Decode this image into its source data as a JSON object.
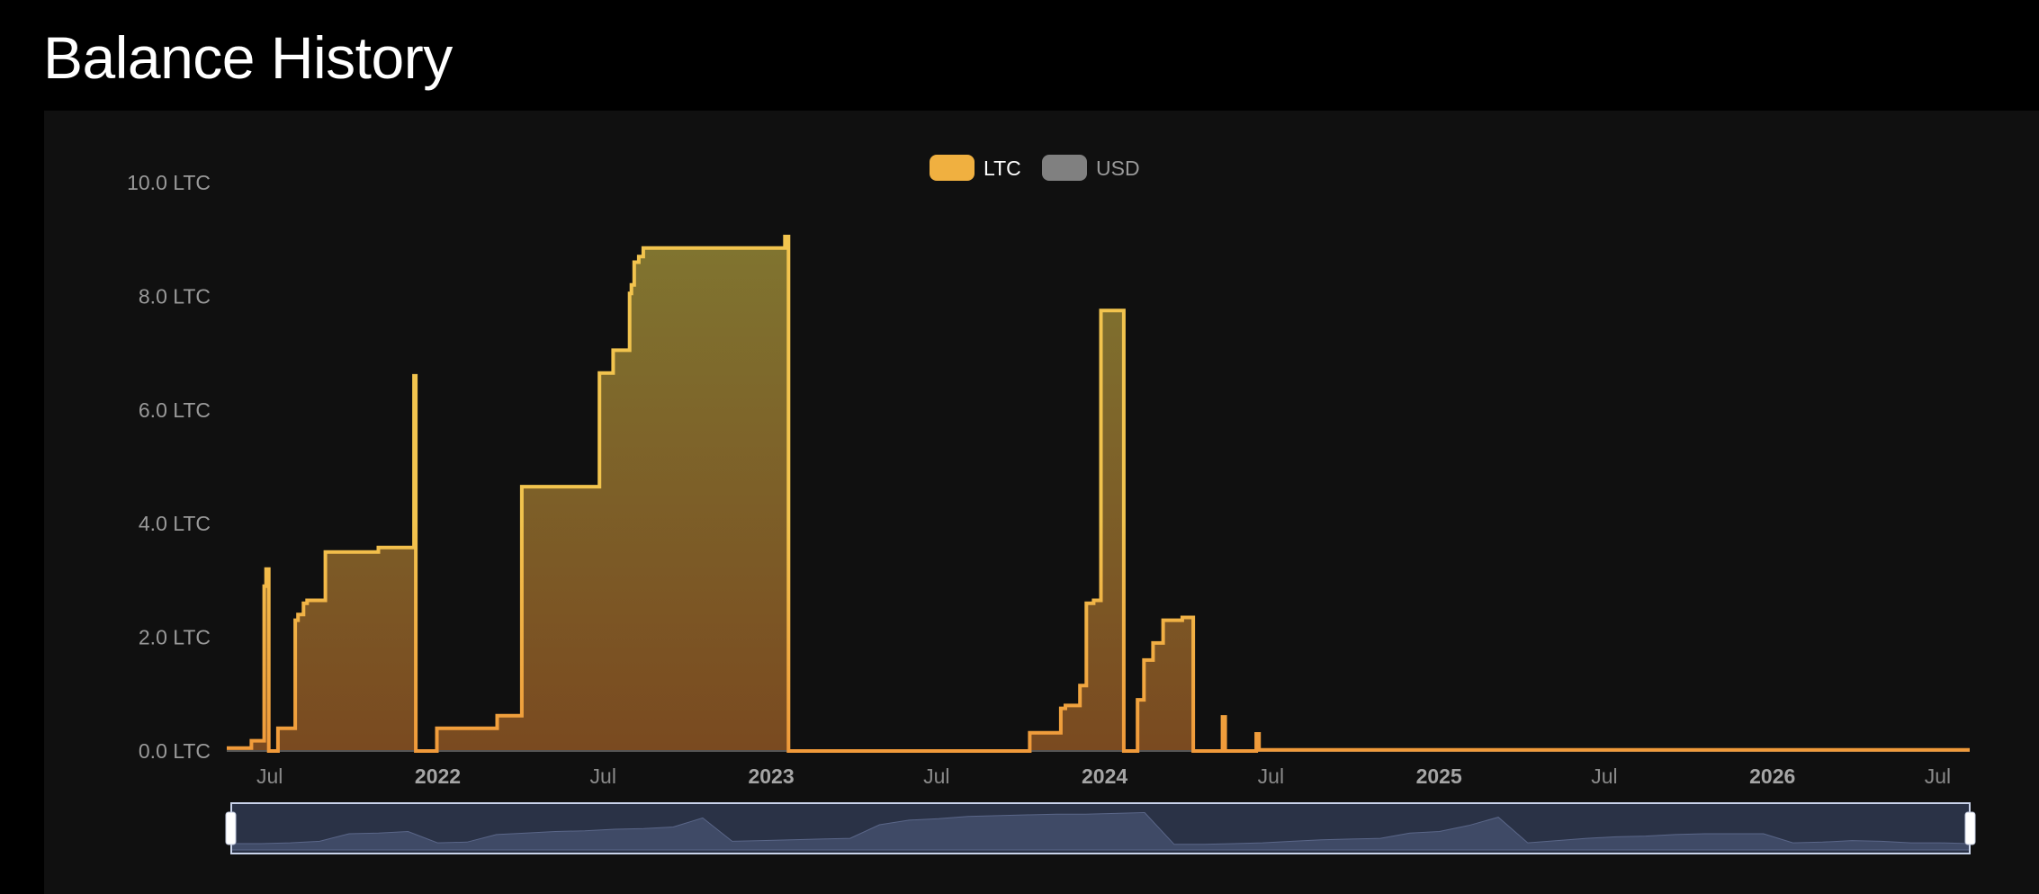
{
  "page": {
    "title": "Balance History"
  },
  "legend": [
    {
      "label": "LTC",
      "color": "#f0b040",
      "text_color": "#ffffff",
      "active": true
    },
    {
      "label": "USD",
      "color": "#808080",
      "text_color": "#9a9a9a",
      "active": false
    }
  ],
  "colors": {
    "line_ltc": "#f2c44e",
    "line_ltc_low": "#f09a3a",
    "fill_top": "#807530",
    "fill_bottom": "#7a4a20",
    "axis": "#555555",
    "navigator_fill": "#2a3246",
    "navigator_series": "#3f4a66",
    "navigator_border": "#c9d3ea",
    "background": "#101010"
  },
  "chart_data": {
    "type": "area",
    "step": true,
    "x_axis": {
      "type": "date",
      "min": "2021-05-15",
      "max": "2026-08-05",
      "ticks": [
        {
          "date": "2021-07-01",
          "label": "Jul",
          "year": false
        },
        {
          "date": "2022-01-01",
          "label": "2022",
          "year": true
        },
        {
          "date": "2022-07-01",
          "label": "Jul",
          "year": false
        },
        {
          "date": "2023-01-01",
          "label": "2023",
          "year": true
        },
        {
          "date": "2023-07-01",
          "label": "Jul",
          "year": false
        },
        {
          "date": "2024-01-01",
          "label": "2024",
          "year": true
        },
        {
          "date": "2024-07-01",
          "label": "Jul",
          "year": false
        },
        {
          "date": "2025-01-01",
          "label": "2025",
          "year": true
        },
        {
          "date": "2025-07-01",
          "label": "Jul",
          "year": false
        },
        {
          "date": "2026-01-01",
          "label": "2026",
          "year": true
        },
        {
          "date": "2026-07-01",
          "label": "Jul",
          "year": false
        }
      ]
    },
    "y_axis": {
      "min": 0,
      "max": 10,
      "ticks": [
        {
          "value": 0,
          "label": "0.0 LTC"
        },
        {
          "value": 2,
          "label": "2.0 LTC"
        },
        {
          "value": 4,
          "label": "4.0 LTC"
        },
        {
          "value": 6,
          "label": "6.0 LTC"
        },
        {
          "value": 8,
          "label": "8.0 LTC"
        },
        {
          "value": 10,
          "label": "10.0 LTC"
        }
      ]
    },
    "series": [
      {
        "name": "LTC",
        "points": [
          [
            "2021-05-15",
            0.05
          ],
          [
            "2021-06-11",
            0.18
          ],
          [
            "2021-06-25",
            2.9
          ],
          [
            "2021-06-27",
            3.2
          ],
          [
            "2021-06-30",
            0.0
          ],
          [
            "2021-07-10",
            0.4
          ],
          [
            "2021-07-29",
            2.3
          ],
          [
            "2021-08-01",
            2.4
          ],
          [
            "2021-08-07",
            2.6
          ],
          [
            "2021-08-11",
            2.65
          ],
          [
            "2021-08-31",
            3.5
          ],
          [
            "2021-10-28",
            3.58
          ],
          [
            "2021-12-06",
            6.6
          ],
          [
            "2021-12-08",
            0.0
          ],
          [
            "2021-12-31",
            0.4
          ],
          [
            "2022-03-07",
            0.62
          ],
          [
            "2022-04-03",
            4.65
          ],
          [
            "2022-06-27",
            6.65
          ],
          [
            "2022-07-12",
            7.05
          ],
          [
            "2022-07-30",
            8.05
          ],
          [
            "2022-08-01",
            8.2
          ],
          [
            "2022-08-04",
            8.6
          ],
          [
            "2022-08-09",
            8.7
          ],
          [
            "2022-08-14",
            8.85
          ],
          [
            "2023-01-16",
            9.05
          ],
          [
            "2023-01-20",
            0.0
          ],
          [
            "2023-10-11",
            0.32
          ],
          [
            "2023-11-14",
            0.75
          ],
          [
            "2023-11-19",
            0.8
          ],
          [
            "2023-12-05",
            1.15
          ],
          [
            "2023-12-12",
            2.6
          ],
          [
            "2023-12-20",
            2.65
          ],
          [
            "2023-12-28",
            7.75
          ],
          [
            "2024-01-22",
            0.0
          ],
          [
            "2024-02-06",
            0.9
          ],
          [
            "2024-02-13",
            1.6
          ],
          [
            "2024-02-23",
            1.9
          ],
          [
            "2024-03-05",
            2.3
          ],
          [
            "2024-03-26",
            2.35
          ],
          [
            "2024-04-07",
            0.0
          ],
          [
            "2024-05-09",
            0.6
          ],
          [
            "2024-05-12",
            0.0
          ],
          [
            "2024-06-15",
            0.3
          ],
          [
            "2024-06-18",
            0.02
          ],
          [
            "2026-08-05",
            0.02
          ]
        ]
      }
    ],
    "navigator": {
      "values": [
        0.6,
        0.6,
        0.7,
        0.9,
        1.9,
        2.0,
        2.2,
        0.7,
        0.8,
        1.8,
        2.0,
        2.2,
        2.3,
        2.5,
        2.6,
        2.8,
        4.0,
        0.9,
        1.0,
        1.1,
        1.2,
        1.3,
        3.1,
        3.7,
        3.9,
        4.2,
        4.3,
        4.4,
        4.5,
        4.5,
        4.6,
        4.7,
        0.5,
        0.5,
        0.6,
        0.7,
        0.9,
        1.1,
        1.2,
        1.3,
        2.0,
        2.2,
        3.0,
        4.1,
        0.7,
        1.0,
        1.3,
        1.5,
        1.6,
        1.8,
        1.9,
        1.9,
        1.9,
        0.7,
        0.8,
        1.0,
        0.9,
        0.7,
        0.7,
        0.6
      ]
    }
  }
}
